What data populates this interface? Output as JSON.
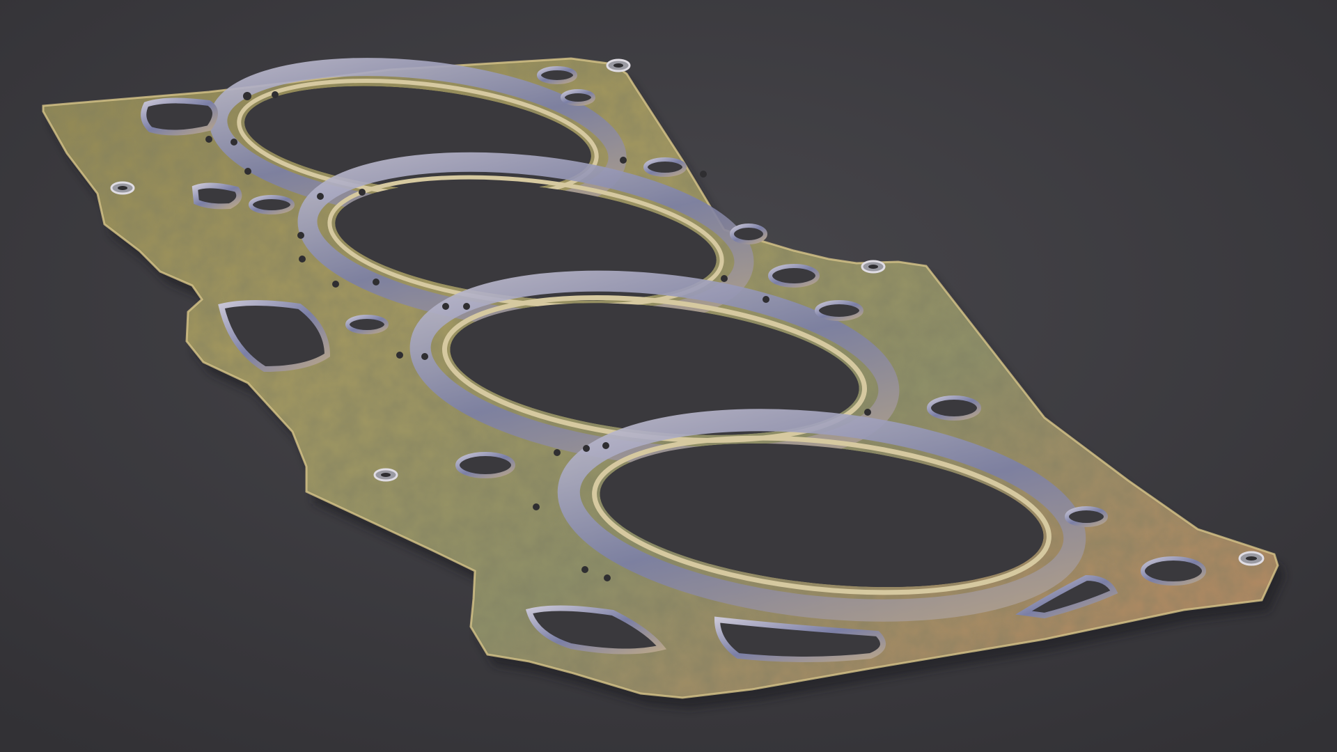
{
  "image": {
    "subject": "cylinder-head-gasket",
    "colors": {
      "background_light": "#454449",
      "background_dark": "#333236",
      "metal_gold": "#9c9058",
      "metal_gold_dark": "#6f6a40",
      "metal_copper": "#c08a60",
      "bead_blue": "#7b7fa6",
      "bead_highlight": "#c9c6d6",
      "edge": "#d8c58a",
      "hole_fill": "#3a393d",
      "shadow": "#222124"
    },
    "cylinder_bore_count": 4
  }
}
